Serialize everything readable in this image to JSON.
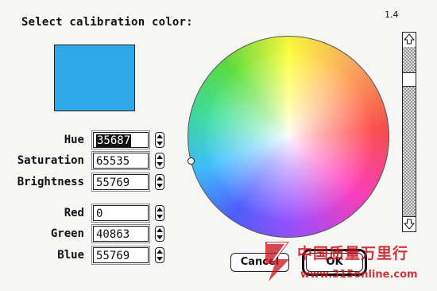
{
  "dialog": {
    "title": "Select calibration color:",
    "version": "1.4",
    "current_color": "#2fa9e8"
  },
  "fields": {
    "hue": {
      "label": "Hue",
      "value": "35687"
    },
    "saturation": {
      "label": "Saturation",
      "value": "65535"
    },
    "brightness": {
      "label": "Brightness",
      "value": "55769"
    },
    "red": {
      "label": "Red",
      "value": "0"
    },
    "green": {
      "label": "Green",
      "value": "40863"
    },
    "blue": {
      "label": "Blue",
      "value": "55769"
    }
  },
  "buttons": {
    "cancel": "Cancel",
    "ok": "OK"
  },
  "watermark": {
    "brand_cn": "中国质量万里行",
    "url": "www.315online.com"
  },
  "icons": {
    "stepper": "up-down-arrows-icon",
    "scroll_up": "up-arrow-icon",
    "scroll_down": "down-arrow-icon"
  }
}
